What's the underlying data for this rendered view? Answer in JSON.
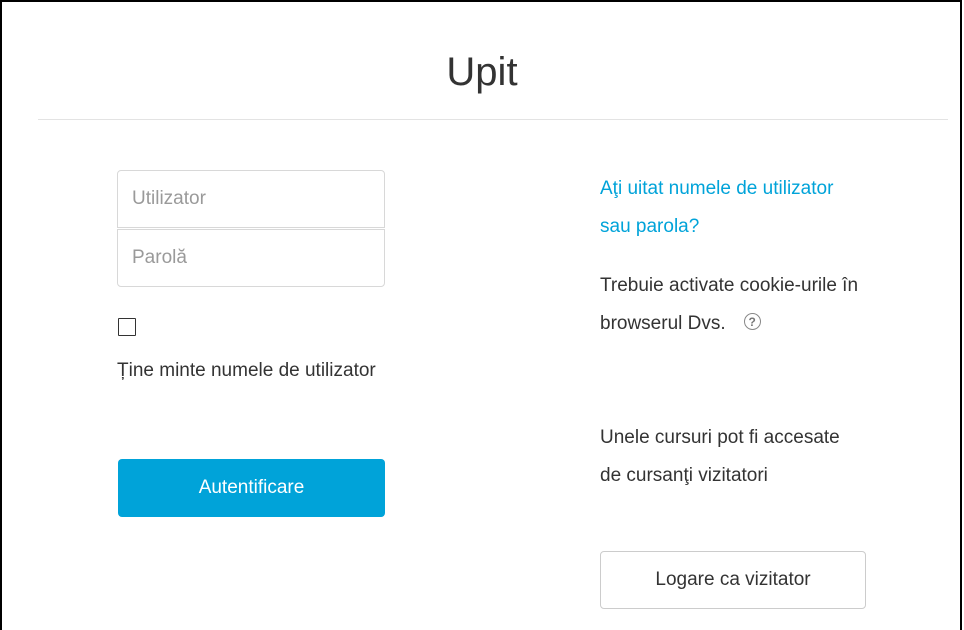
{
  "page": {
    "title": "Upit"
  },
  "login_form": {
    "username_placeholder": "Utilizator",
    "password_placeholder": "Parolă",
    "remember_label": "Ține minte numele de utilizator",
    "submit_label": "Autentificare",
    "remember_checked": false
  },
  "side_panel": {
    "forgot_link": "Aţi uitat numele de utilizator sau parola?",
    "cookies_text": "Trebuie activate cookie-urile în browserul Dvs.",
    "help_icon_glyph": "?",
    "guest_text": "Unele cursuri pot fi accesate de cursanţi vizitatori",
    "guest_button_label": "Logare ca vizitator"
  },
  "colors": {
    "accent": "#00a3d9",
    "text": "#333333",
    "border": "#d8d8d8"
  }
}
